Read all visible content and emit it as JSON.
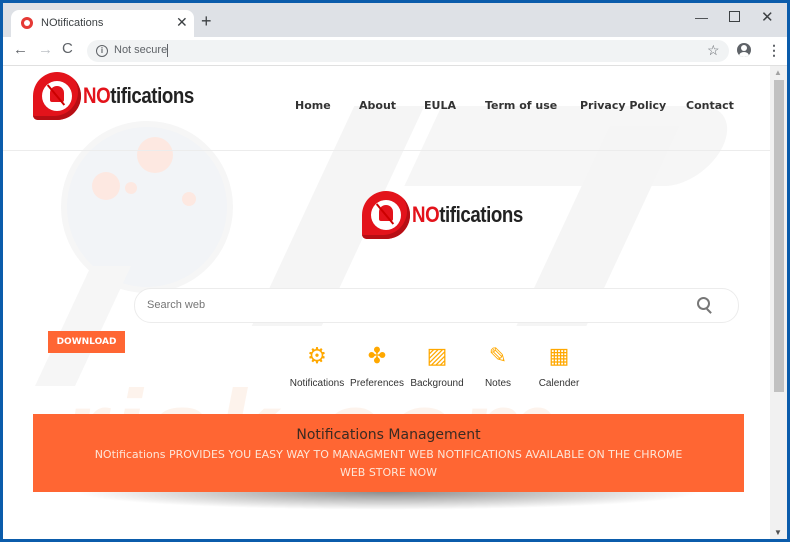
{
  "browser": {
    "tab_title": "NOtifications",
    "tab_close": "✕",
    "new_tab": "+",
    "minimize": "—",
    "close": "✕",
    "back": "←",
    "forward": "→",
    "reload": "C",
    "info": "i",
    "security_label": "Not secure",
    "star": "☆",
    "menu": "⋮"
  },
  "site": {
    "logo_no": "NO",
    "logo_rest": "tifications",
    "nav": [
      "Home",
      "About",
      "EULA",
      "Term of use",
      "Privacy Policy",
      "Contact"
    ],
    "search_placeholder": "Search web",
    "download_label": "DOWNLOAD",
    "features": [
      {
        "label": "Notifications",
        "icon": "⚙"
      },
      {
        "label": "Preferences",
        "icon": "✤"
      },
      {
        "label": "Background",
        "icon": "▨"
      },
      {
        "label": "Notes",
        "icon": "✎"
      },
      {
        "label": "Calender",
        "icon": "▦"
      }
    ],
    "banner_title": "Notifications Management",
    "banner_text": "NOtifications PROVIDES YOU EASY WAY TO MANAGMENT WEB NOTIFICATIONS AVAILABLE ON THE CHROME WEB STORE NOW",
    "watermark": "risk.com"
  },
  "colors": {
    "accent": "#ff6633",
    "logo_red": "#e3131b",
    "icon_orange": "#ffa800",
    "window_frame": "#0b5cab"
  }
}
